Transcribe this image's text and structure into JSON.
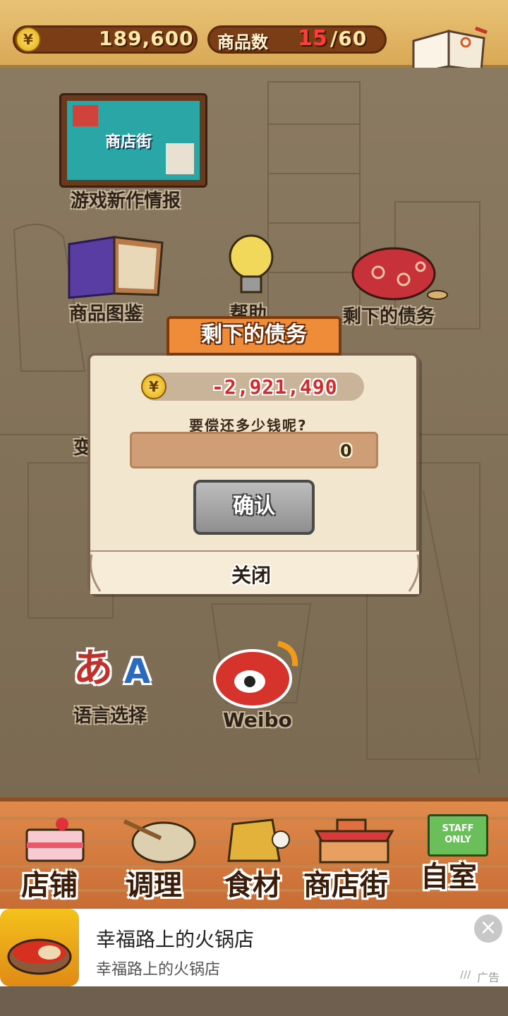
{
  "topbar": {
    "money_icon": "¥",
    "money": "189,600",
    "product_label": "商品数",
    "product_count": "15",
    "product_max": "/60",
    "recipe_label": "食谱"
  },
  "menu": {
    "news": "游戏新作情报",
    "catalog": "商品图鉴",
    "help": "帮助",
    "debt": "剩下的债务",
    "language": "语言选择",
    "weibo": "Weibo",
    "promo_title": "商店街",
    "partial_left": "变"
  },
  "dialog": {
    "title": "剩下的债务",
    "coin_icon": "¥",
    "remaining_debt": "-2,921,490",
    "question": "要偿还多少钱呢?",
    "amount": "0",
    "confirm_label": "确认",
    "close_label": "关闭"
  },
  "nav": {
    "items": [
      {
        "label": "店铺"
      },
      {
        "label": "调理"
      },
      {
        "label": "食材"
      },
      {
        "label": "商店街"
      },
      {
        "label": "自室"
      }
    ],
    "staff_sign": "STAFF ONLY"
  },
  "ad": {
    "title": "幸福路上的火锅店",
    "subtitle": "幸福路上的火锅店",
    "tag": "广告"
  },
  "colors": {
    "accent_orange": "#ef8c3a",
    "debt_red": "#d42a2a",
    "topbar": "#e9c277"
  }
}
